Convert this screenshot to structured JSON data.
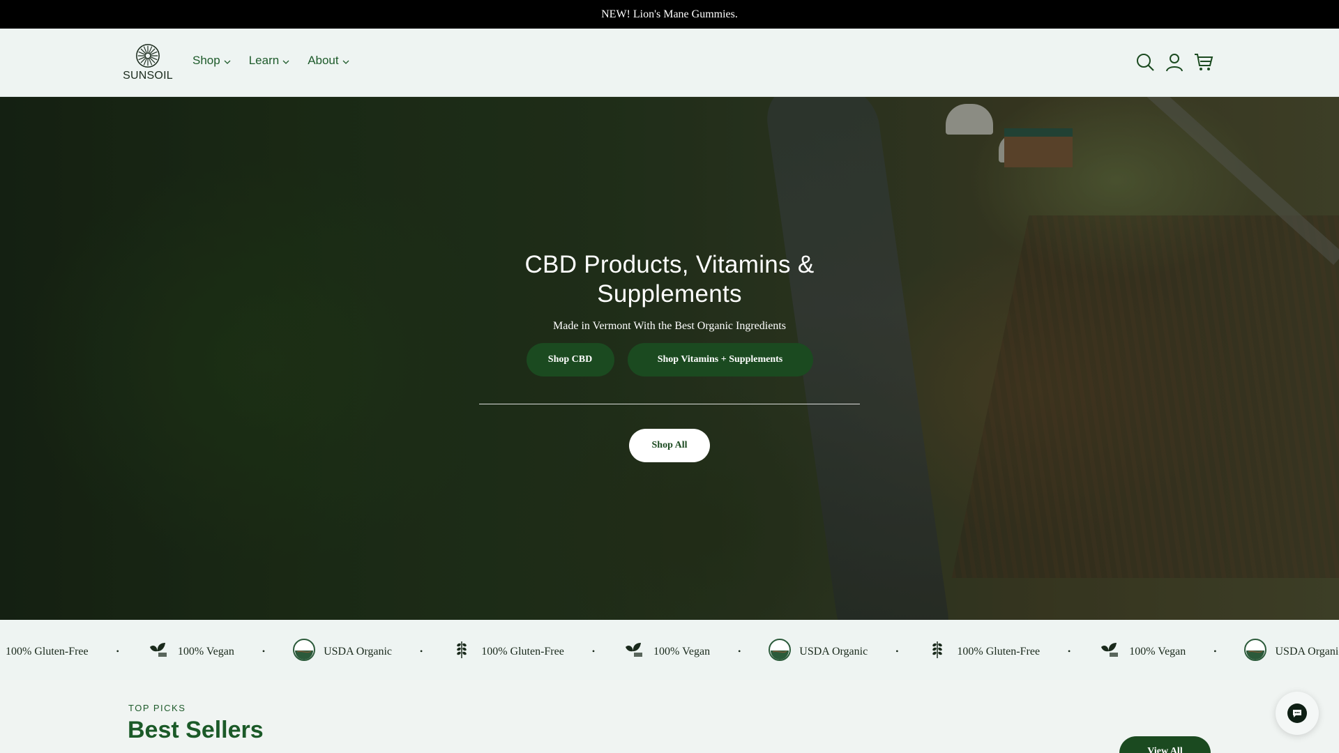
{
  "announcement": {
    "text": "NEW! Lion's Mane Gummies."
  },
  "header": {
    "logo_text": "SUNSOIL",
    "nav": [
      {
        "label": "Shop"
      },
      {
        "label": "Learn"
      },
      {
        "label": "About"
      }
    ],
    "icons": [
      "search-icon",
      "account-icon",
      "cart-icon"
    ]
  },
  "hero": {
    "title": "CBD Products, Vitamins & Supplements",
    "subtitle": "Made in Vermont With the Best Organic Ingredients",
    "buttons": {
      "shop_cbd": "Shop CBD",
      "shop_vitamins": "Shop Vitamins + Supplements",
      "shop_all": "Shop All"
    }
  },
  "marquee": {
    "items": [
      {
        "label": "100% Gluten-Free",
        "icon": "gluten-free-badge-icon"
      },
      {
        "label": "100% Vegan",
        "icon": "vegan-badge-icon"
      },
      {
        "label": "USDA Organic",
        "icon": "usda-organic-badge-icon"
      },
      {
        "label": "100% Gluten-Free",
        "icon": "gluten-free-badge-icon"
      },
      {
        "label": "100% Vegan",
        "icon": "vegan-badge-icon"
      },
      {
        "label": "USDA Organic",
        "icon": "usda-organic-badge-icon"
      },
      {
        "label": "100% Gluten-Free",
        "icon": "gluten-free-badge-icon"
      },
      {
        "label": "100% Vegan",
        "icon": "vegan-badge-icon"
      },
      {
        "label": "USDA Organic",
        "icon": "usda-organic-badge-icon"
      }
    ]
  },
  "section": {
    "eyebrow": "TOP PICKS",
    "title": "Best Sellers",
    "view_all": "View All"
  },
  "colors": {
    "brand_green": "#1b4a20",
    "nav_green": "#1d5a2a",
    "background": "#eef4f2",
    "announcement_bg": "#000000"
  }
}
